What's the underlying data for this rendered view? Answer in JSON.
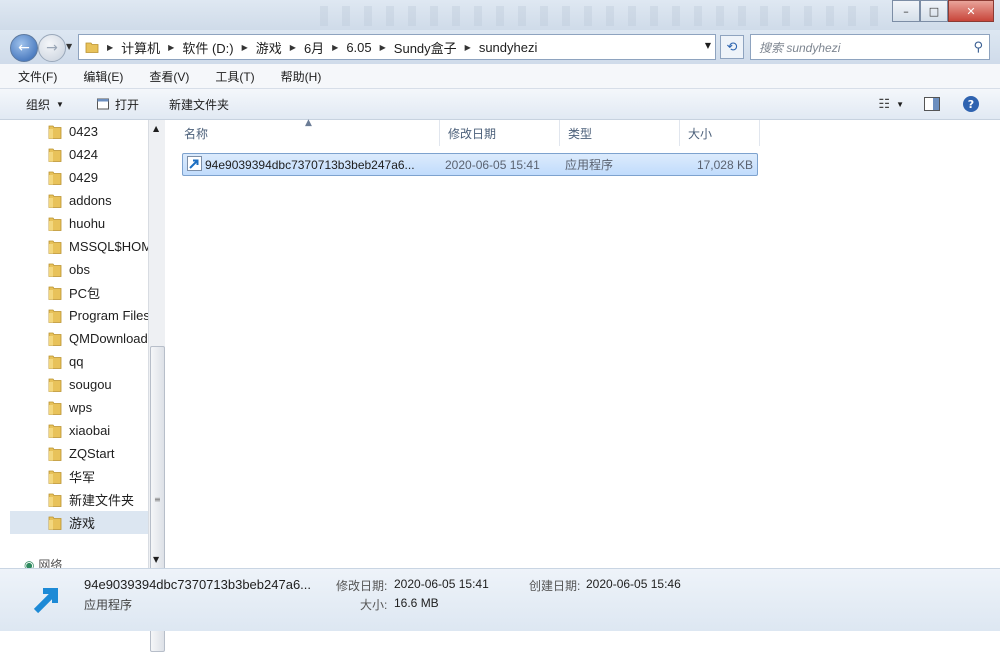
{
  "window": {
    "min_label": "–",
    "max_label": "□",
    "close_label": "✕"
  },
  "address": {
    "crumbs": [
      "计算机",
      "软件 (D:)",
      "游戏",
      "6月",
      "6.05",
      "Sundy盒子",
      "sundyhezi"
    ],
    "search_placeholder": "搜索 sundyhezi"
  },
  "menu": [
    "文件(F)",
    "编辑(E)",
    "查看(V)",
    "工具(T)",
    "帮助(H)"
  ],
  "toolbar": {
    "organize": "组织",
    "open": "打开",
    "new_folder": "新建文件夹"
  },
  "nav": {
    "items": [
      "0423",
      "0424",
      "0429",
      "addons",
      "huohu",
      "MSSQL$HOM",
      "obs",
      "PC包",
      "Program Files",
      "QMDownload",
      "qq",
      "sougou",
      "wps",
      "xiaobai",
      "ZQStart",
      "华军",
      "新建文件夹",
      "游戏"
    ],
    "selected_index": 17,
    "network": "网络"
  },
  "columns": {
    "name": "名称",
    "date": "修改日期",
    "type": "类型",
    "size": "大小"
  },
  "files": [
    {
      "name": "94e9039394dbc7370713b3beb247a6...",
      "date": "2020-06-05 15:41",
      "type": "应用程序",
      "size": "17,028 KB"
    }
  ],
  "details": {
    "name": "94e9039394dbc7370713b3beb247a6...",
    "type": "应用程序",
    "modified_label": "修改日期:",
    "modified": "2020-06-05 15:41",
    "created_label": "创建日期:",
    "created": "2020-06-05 15:46",
    "size_label": "大小:",
    "size": "16.6 MB"
  },
  "colors": {
    "folder": "#e8c25a",
    "selection": "#c9e0fc",
    "accent": "#2f63b0"
  }
}
